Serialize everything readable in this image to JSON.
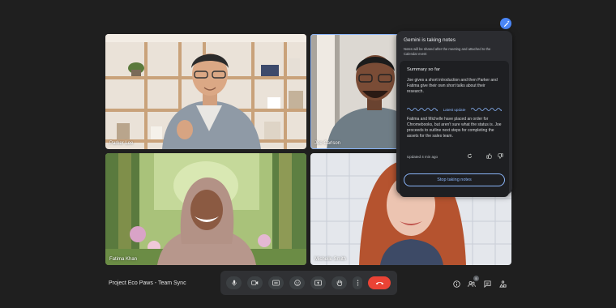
{
  "meeting": {
    "title": "Project Eco Paws - Team Sync"
  },
  "participants": [
    {
      "name": "Parker Lee"
    },
    {
      "name": "Joe Carlson"
    },
    {
      "name": "Fatima Khan"
    },
    {
      "name": "Michelle Smith"
    }
  ],
  "gemini_panel": {
    "title": "Gemini is taking notes",
    "subtitle": "Notes will be shared after the meeting and attached to the Calendar event",
    "summary_title": "Summary so far",
    "summary_text_1": "Joe gives a short introduction and then Parker and Fatima give their own short talks about their research.",
    "latest_update_label": "Latest update",
    "summary_text_2": "Fatima and Michelle have placed an order for Chromebooks, but aren't sure what the status is. Joe proceeds to outline next steps for completing the assets for the sales team.",
    "updated_text": "Updated 4 min ago",
    "stop_button_label": "Stop taking notes"
  },
  "people_count": "5",
  "icons": {
    "gemini": "gemini-sparkle-icon",
    "mic": "mic-icon",
    "camera": "camera-icon",
    "captions": "captions-icon",
    "emoji": "emoji-icon",
    "present": "present-icon",
    "hand": "raise-hand-icon",
    "more": "more-vert-icon",
    "end": "end-call-icon",
    "info": "info-icon",
    "people": "people-icon",
    "chat": "chat-icon",
    "activities": "activities-icon"
  },
  "colors": {
    "background": "#1f1f1f",
    "accent": "#8ab4f8",
    "end_call": "#ea4335",
    "panel": "#2b2c30"
  }
}
